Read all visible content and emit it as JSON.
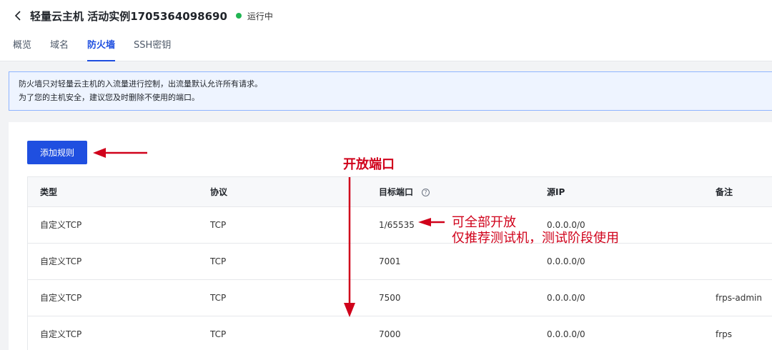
{
  "header": {
    "title": "轻量云主机 活动实例1705364098690",
    "status": "运行中",
    "status_color": "#21b553"
  },
  "tabs": [
    {
      "label": "概览"
    },
    {
      "label": "域名"
    },
    {
      "label": "防火墙"
    },
    {
      "label": "SSH密钥"
    }
  ],
  "active_tab": "防火墙",
  "notice": {
    "line1": "防火墙只对轻量云主机的入流量进行控制，出流量默认允许所有请求。",
    "line2": "为了您的主机安全，建议您及时删除不使用的端口。"
  },
  "toolbar": {
    "add_rule_label": "添加规则"
  },
  "table": {
    "columns": [
      "类型",
      "协议",
      "目标端口",
      "源IP",
      "备注"
    ],
    "rows": [
      {
        "type": "自定义TCP",
        "protocol": "TCP",
        "port": "1/65535",
        "source": "0.0.0.0/0",
        "note": ""
      },
      {
        "type": "自定义TCP",
        "protocol": "TCP",
        "port": "7001",
        "source": "0.0.0.0/0",
        "note": ""
      },
      {
        "type": "自定义TCP",
        "protocol": "TCP",
        "port": "7500",
        "source": "0.0.0.0/0",
        "note": "frps-admin"
      },
      {
        "type": "自定义TCP",
        "protocol": "TCP",
        "port": "7000",
        "source": "0.0.0.0/0",
        "note": "frps"
      }
    ]
  },
  "annotations": {
    "top": "开放端口",
    "right_line1": "可全部开放",
    "right_line2": "仅推荐测试机，测试阶段使用",
    "color": "#d0021b"
  },
  "icons": {
    "back": "chevron-left-icon",
    "help": "help-circle-icon"
  }
}
